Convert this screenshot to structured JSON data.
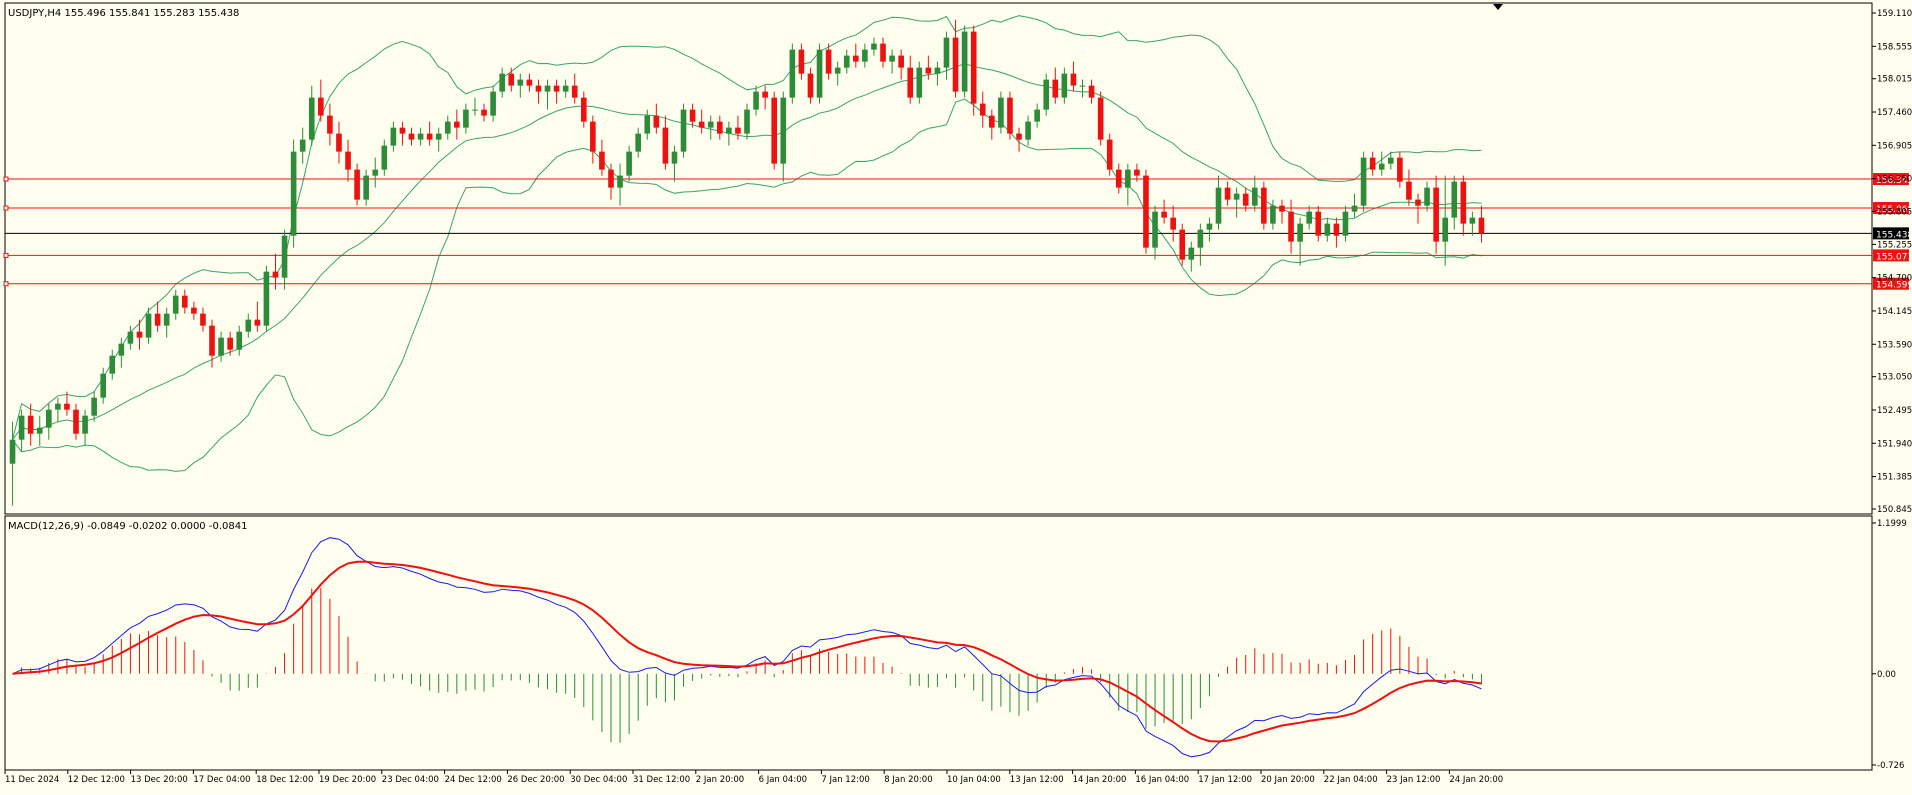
{
  "header": {
    "symbol_text": "USDJPY,H4  155.496 155.841 155.283 155.438",
    "macd_text": "MACD(12,26,9) -0.0849 -0.0202 0.0000 -0.0841"
  },
  "colors": {
    "background": "#fefeee",
    "bull": "#2e8b3a",
    "bear": "#ee1111",
    "bands": "#3aa36a",
    "macd_line": "#1a1aee",
    "signal_line": "#ee1111",
    "hline": "#ee1111",
    "current_price": "#000000"
  },
  "chart_data": [
    {
      "type": "candlestick",
      "symbol": "USDJPY",
      "timeframe": "H4",
      "ylim": [
        150.845,
        159.11
      ],
      "price_ticks": [
        "159.110",
        "158.555",
        "158.015",
        "157.460",
        "156.905",
        "156.350",
        "155.805",
        "155.255",
        "154.700",
        "154.145",
        "153.590",
        "153.050",
        "152.495",
        "151.940",
        "151.385",
        "150.845"
      ],
      "time_labels": [
        "11 Dec 2024",
        "12 Dec 12:00",
        "13 Dec 20:00",
        "17 Dec 04:00",
        "18 Dec 12:00",
        "19 Dec 20:00",
        "23 Dec 04:00",
        "24 Dec 12:00",
        "26 Dec 20:00",
        "30 Dec 04:00",
        "31 Dec 12:00",
        "2 Jan 20:00",
        "6 Jan 04:00",
        "7 Jan 12:00",
        "8 Jan 20:00",
        "10 Jan 04:00",
        "13 Jan 12:00",
        "14 Jan 20:00",
        "16 Jan 04:00",
        "17 Jan 12:00",
        "20 Jan 20:00",
        "22 Jan 04:00",
        "23 Jan 12:00",
        "24 Jan 20:00"
      ],
      "current_price": 155.438,
      "current_price_label": "155.438",
      "hlines": [
        {
          "value": 156.343,
          "label": "156.343"
        },
        {
          "value": 155.86,
          "label": "155.860"
        },
        {
          "value": 155.071,
          "label": "155.071"
        },
        {
          "value": 154.599,
          "label": "154.599"
        }
      ],
      "candles": [
        [
          151.6,
          152.3,
          150.9,
          152.0
        ],
        [
          152.0,
          152.5,
          151.8,
          152.4
        ],
        [
          152.4,
          152.6,
          151.9,
          152.1
        ],
        [
          152.1,
          152.4,
          151.9,
          152.2
        ],
        [
          152.2,
          152.6,
          152.0,
          152.5
        ],
        [
          152.5,
          152.7,
          152.3,
          152.6
        ],
        [
          152.6,
          152.8,
          152.4,
          152.5
        ],
        [
          152.5,
          152.6,
          152.0,
          152.1
        ],
        [
          152.1,
          152.5,
          151.9,
          152.4
        ],
        [
          152.4,
          152.8,
          152.3,
          152.7
        ],
        [
          152.7,
          153.2,
          152.6,
          153.1
        ],
        [
          153.1,
          153.5,
          153.0,
          153.4
        ],
        [
          153.4,
          153.7,
          153.2,
          153.6
        ],
        [
          153.6,
          153.9,
          153.5,
          153.8
        ],
        [
          153.8,
          154.0,
          153.5,
          153.7
        ],
        [
          153.7,
          154.2,
          153.6,
          154.1
        ],
        [
          154.1,
          154.3,
          153.8,
          153.9
        ],
        [
          153.9,
          154.2,
          153.7,
          154.1
        ],
        [
          154.1,
          154.5,
          154.0,
          154.4
        ],
        [
          154.4,
          154.5,
          154.1,
          154.2
        ],
        [
          154.2,
          154.3,
          154.0,
          154.1
        ],
        [
          154.1,
          154.2,
          153.8,
          153.9
        ],
        [
          153.9,
          154.0,
          153.2,
          153.4
        ],
        [
          153.4,
          153.8,
          153.3,
          153.7
        ],
        [
          153.7,
          153.8,
          153.4,
          153.5
        ],
        [
          153.5,
          153.9,
          153.4,
          153.8
        ],
        [
          153.8,
          154.1,
          153.7,
          154.0
        ],
        [
          154.0,
          154.3,
          153.8,
          153.9
        ],
        [
          153.9,
          154.9,
          153.8,
          154.8
        ],
        [
          154.8,
          155.1,
          154.5,
          154.7
        ],
        [
          154.7,
          155.5,
          154.5,
          155.4
        ],
        [
          155.4,
          157.0,
          155.2,
          156.8
        ],
        [
          156.8,
          157.2,
          156.6,
          157.0
        ],
        [
          157.0,
          157.9,
          156.9,
          157.7
        ],
        [
          157.7,
          158.0,
          157.3,
          157.4
        ],
        [
          157.4,
          157.6,
          156.9,
          157.1
        ],
        [
          157.1,
          157.3,
          156.6,
          156.8
        ],
        [
          156.8,
          157.0,
          156.3,
          156.5
        ],
        [
          156.5,
          156.6,
          155.9,
          156.0
        ],
        [
          156.0,
          156.5,
          155.9,
          156.4
        ],
        [
          156.4,
          156.7,
          156.2,
          156.5
        ],
        [
          156.5,
          157.0,
          156.4,
          156.9
        ],
        [
          156.9,
          157.3,
          156.8,
          157.2
        ],
        [
          157.2,
          157.3,
          156.9,
          157.1
        ],
        [
          157.1,
          157.2,
          156.9,
          157.0
        ],
        [
          157.0,
          157.2,
          156.9,
          157.1
        ],
        [
          157.1,
          157.3,
          156.9,
          157.0
        ],
        [
          157.0,
          157.2,
          156.8,
          157.1
        ],
        [
          157.1,
          157.4,
          157.0,
          157.3
        ],
        [
          157.3,
          157.5,
          157.0,
          157.2
        ],
        [
          157.2,
          157.6,
          157.1,
          157.5
        ],
        [
          157.5,
          157.7,
          157.4,
          157.5
        ],
        [
          157.5,
          157.6,
          157.3,
          157.4
        ],
        [
          157.4,
          157.9,
          157.3,
          157.8
        ],
        [
          157.8,
          158.2,
          157.7,
          158.1
        ],
        [
          158.1,
          158.2,
          157.8,
          157.9
        ],
        [
          157.9,
          158.1,
          157.7,
          158.0
        ],
        [
          158.0,
          158.1,
          157.8,
          157.9
        ],
        [
          157.9,
          158.0,
          157.6,
          157.8
        ],
        [
          157.8,
          158.0,
          157.5,
          157.9
        ],
        [
          157.9,
          158.0,
          157.6,
          157.8
        ],
        [
          157.8,
          158.0,
          157.7,
          157.9
        ],
        [
          157.9,
          158.1,
          157.6,
          157.7
        ],
        [
          157.7,
          157.8,
          157.2,
          157.3
        ],
        [
          157.3,
          157.4,
          156.6,
          156.8
        ],
        [
          156.8,
          157.0,
          156.4,
          156.5
        ],
        [
          156.5,
          156.6,
          156.0,
          156.2
        ],
        [
          156.2,
          156.6,
          155.9,
          156.4
        ],
        [
          156.4,
          156.9,
          156.3,
          156.8
        ],
        [
          156.8,
          157.2,
          156.7,
          157.1
        ],
        [
          157.1,
          157.5,
          157.0,
          157.4
        ],
        [
          157.4,
          157.6,
          157.1,
          157.2
        ],
        [
          157.2,
          157.4,
          156.5,
          156.6
        ],
        [
          156.6,
          156.9,
          156.3,
          156.8
        ],
        [
          156.8,
          157.6,
          156.7,
          157.5
        ],
        [
          157.5,
          157.6,
          157.2,
          157.3
        ],
        [
          157.3,
          157.5,
          157.1,
          157.2
        ],
        [
          157.2,
          157.4,
          157.0,
          157.3
        ],
        [
          157.3,
          157.4,
          157.0,
          157.1
        ],
        [
          157.1,
          157.3,
          156.9,
          157.2
        ],
        [
          157.2,
          157.4,
          157.0,
          157.1
        ],
        [
          157.1,
          157.6,
          157.0,
          157.5
        ],
        [
          157.5,
          157.9,
          157.4,
          157.8
        ],
        [
          157.8,
          157.9,
          157.5,
          157.7
        ],
        [
          157.7,
          157.8,
          156.5,
          156.6
        ],
        [
          156.6,
          157.8,
          156.3,
          157.7
        ],
        [
          157.7,
          158.6,
          157.6,
          158.5
        ],
        [
          158.5,
          158.6,
          158.0,
          158.1
        ],
        [
          158.1,
          158.2,
          157.6,
          157.7
        ],
        [
          157.7,
          158.6,
          157.6,
          158.5
        ],
        [
          158.5,
          158.6,
          158.0,
          158.1
        ],
        [
          158.1,
          158.3,
          157.9,
          158.2
        ],
        [
          158.2,
          158.5,
          158.1,
          158.4
        ],
        [
          158.4,
          158.6,
          158.2,
          158.3
        ],
        [
          158.3,
          158.6,
          158.2,
          158.5
        ],
        [
          158.5,
          158.7,
          158.4,
          158.6
        ],
        [
          158.6,
          158.7,
          158.2,
          158.3
        ],
        [
          158.3,
          158.5,
          158.1,
          158.4
        ],
        [
          158.4,
          158.5,
          158.0,
          158.2
        ],
        [
          158.2,
          158.4,
          157.6,
          157.7
        ],
        [
          157.7,
          158.3,
          157.6,
          158.2
        ],
        [
          158.2,
          158.4,
          158.0,
          158.1
        ],
        [
          158.1,
          158.3,
          157.9,
          158.2
        ],
        [
          158.2,
          158.8,
          158.0,
          158.7
        ],
        [
          158.7,
          159.0,
          157.7,
          157.8
        ],
        [
          157.8,
          158.9,
          157.7,
          158.8
        ],
        [
          158.8,
          158.9,
          157.4,
          157.6
        ],
        [
          157.6,
          157.8,
          157.2,
          157.4
        ],
        [
          157.4,
          157.5,
          157.0,
          157.2
        ],
        [
          157.2,
          157.8,
          157.1,
          157.7
        ],
        [
          157.7,
          157.8,
          157.0,
          157.1
        ],
        [
          157.1,
          157.2,
          156.8,
          157.0
        ],
        [
          157.0,
          157.4,
          156.9,
          157.3
        ],
        [
          157.3,
          157.6,
          157.2,
          157.5
        ],
        [
          157.5,
          158.1,
          157.4,
          158.0
        ],
        [
          158.0,
          158.2,
          157.6,
          157.7
        ],
        [
          157.7,
          158.2,
          157.6,
          158.1
        ],
        [
          158.1,
          158.3,
          157.8,
          157.9
        ],
        [
          157.9,
          158.0,
          157.7,
          157.9
        ],
        [
          157.9,
          158.0,
          157.6,
          157.7
        ],
        [
          157.7,
          157.8,
          156.9,
          157.0
        ],
        [
          157.0,
          157.1,
          156.4,
          156.5
        ],
        [
          156.5,
          156.6,
          156.1,
          156.2
        ],
        [
          156.2,
          156.6,
          155.9,
          156.5
        ],
        [
          156.5,
          156.6,
          156.3,
          156.4
        ],
        [
          156.4,
          156.5,
          155.1,
          155.2
        ],
        [
          155.2,
          155.9,
          155.0,
          155.8
        ],
        [
          155.8,
          156.0,
          155.6,
          155.7
        ],
        [
          155.7,
          155.9,
          155.3,
          155.5
        ],
        [
          155.5,
          155.6,
          154.9,
          155.0
        ],
        [
          155.0,
          155.3,
          154.8,
          155.2
        ],
        [
          155.2,
          155.6,
          154.9,
          155.5
        ],
        [
          155.5,
          155.7,
          155.3,
          155.6
        ],
        [
          155.6,
          156.4,
          155.5,
          156.2
        ],
        [
          156.2,
          156.3,
          155.9,
          156.0
        ],
        [
          156.0,
          156.2,
          155.7,
          156.1
        ],
        [
          156.1,
          156.2,
          155.8,
          155.9
        ],
        [
          155.9,
          156.4,
          155.8,
          156.2
        ],
        [
          156.2,
          156.3,
          155.5,
          155.6
        ],
        [
          155.6,
          156.0,
          155.5,
          155.9
        ],
        [
          155.9,
          156.0,
          155.6,
          155.8
        ],
        [
          155.8,
          156.0,
          155.1,
          155.3
        ],
        [
          155.3,
          155.7,
          154.9,
          155.6
        ],
        [
          155.6,
          155.9,
          155.5,
          155.8
        ],
        [
          155.8,
          155.9,
          155.3,
          155.4
        ],
        [
          155.4,
          155.7,
          155.3,
          155.6
        ],
        [
          155.6,
          155.7,
          155.2,
          155.4
        ],
        [
          155.4,
          155.9,
          155.3,
          155.8
        ],
        [
          155.8,
          156.1,
          155.7,
          155.9
        ],
        [
          155.9,
          156.8,
          155.8,
          156.7
        ],
        [
          156.7,
          156.8,
          156.4,
          156.5
        ],
        [
          156.5,
          156.8,
          156.4,
          156.6
        ],
        [
          156.6,
          156.8,
          156.5,
          156.7
        ],
        [
          156.7,
          156.8,
          156.2,
          156.3
        ],
        [
          156.3,
          156.5,
          155.9,
          156.0
        ],
        [
          156.0,
          156.1,
          155.6,
          155.9
        ],
        [
          155.9,
          156.3,
          155.8,
          156.2
        ],
        [
          156.2,
          156.4,
          155.1,
          155.3
        ],
        [
          155.3,
          156.4,
          154.9,
          155.7
        ],
        [
          155.7,
          156.4,
          155.5,
          156.3
        ],
        [
          156.3,
          156.4,
          155.4,
          155.6
        ],
        [
          155.6,
          155.8,
          155.4,
          155.7
        ],
        [
          155.7,
          155.9,
          155.283,
          155.438
        ]
      ]
    },
    {
      "type": "macd",
      "label": "MACD(12,26,9)",
      "ylim": [
        -0.726,
        1.1999
      ],
      "ticks": [
        "1.1999",
        "0.00",
        "-0.726"
      ]
    }
  ]
}
